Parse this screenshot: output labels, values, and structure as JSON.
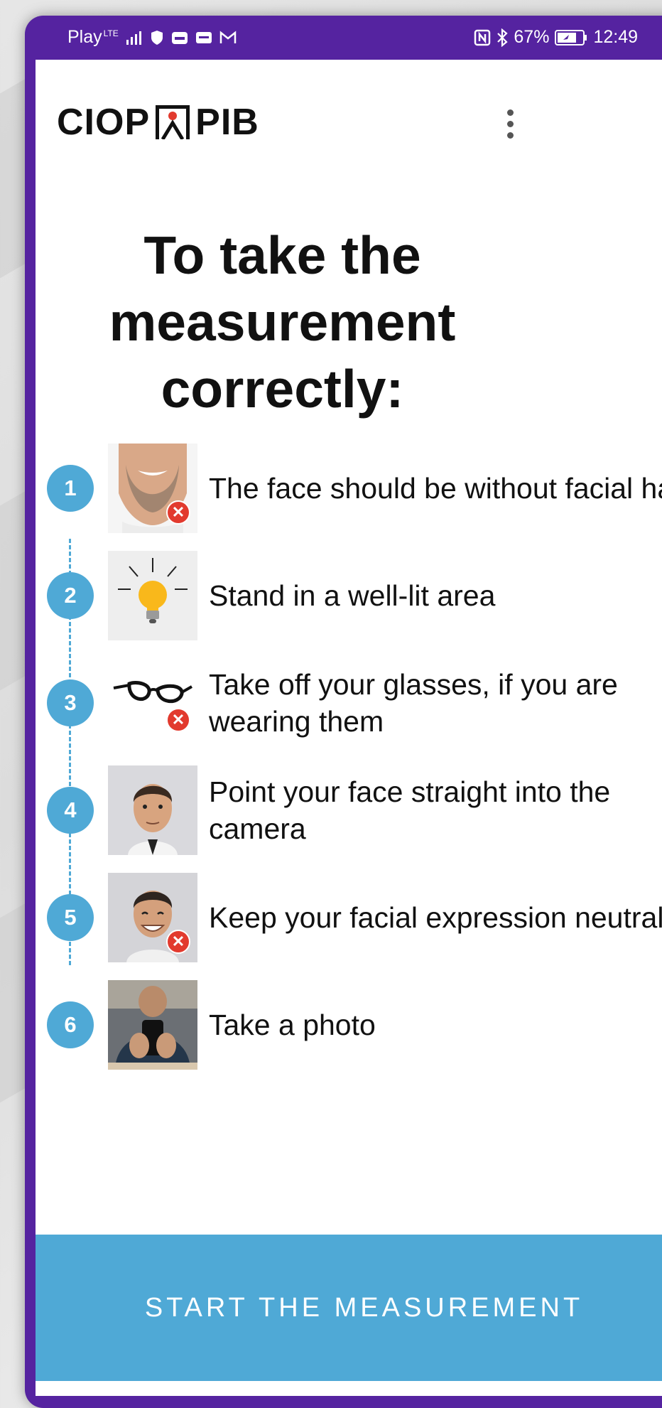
{
  "status_bar": {
    "carrier": "Play",
    "network": "LTE",
    "battery": "67%",
    "time": "12:49"
  },
  "app_bar": {
    "logo_left": "CIOP",
    "logo_right": "PIB"
  },
  "main": {
    "title": "To take the measurement correctly:",
    "steps": [
      {
        "num": "1",
        "text": "The face should be without facial hair"
      },
      {
        "num": "2",
        "text": "Stand in a well-lit area"
      },
      {
        "num": "3",
        "text": "Take off your glasses, if you are wearing them"
      },
      {
        "num": "4",
        "text": "Point your face straight into the camera"
      },
      {
        "num": "5",
        "text": "Keep your facial expression neutral"
      },
      {
        "num": "6",
        "text": "Take a photo"
      }
    ],
    "start_button": "START THE MEASUREMENT"
  },
  "colors": {
    "frame": "#5523a0",
    "accent": "#4fa9d6",
    "error": "#e23a2e"
  }
}
